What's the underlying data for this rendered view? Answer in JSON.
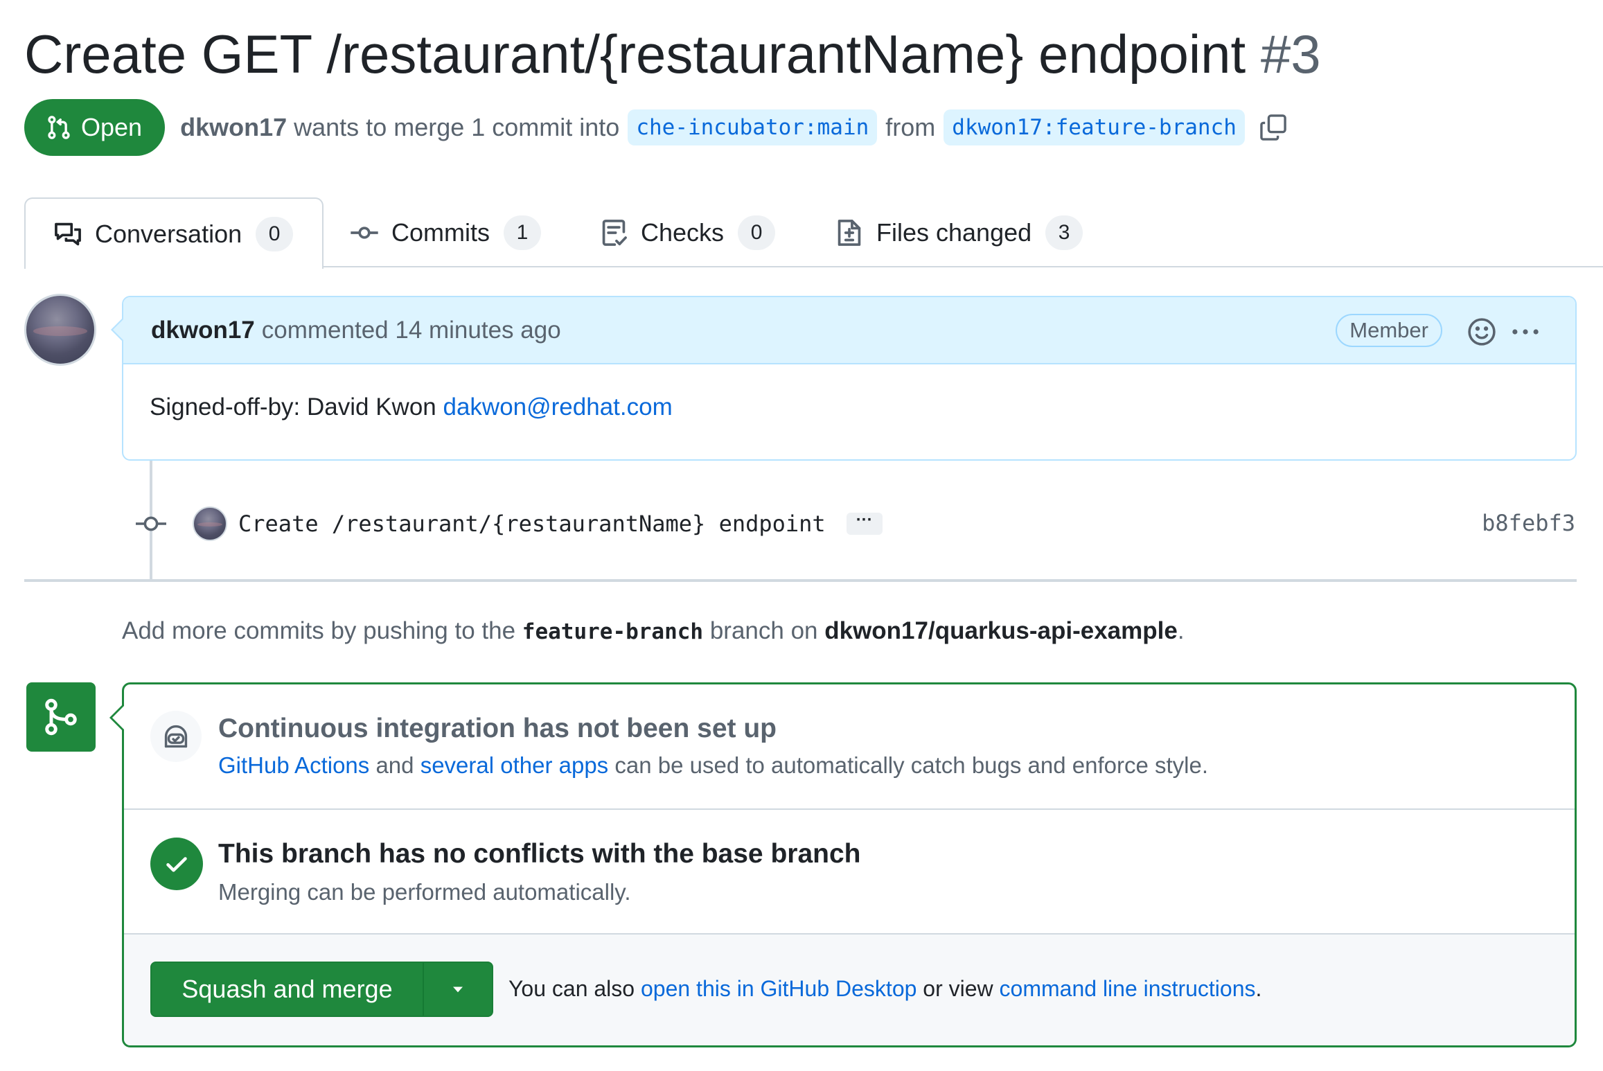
{
  "pr": {
    "title": "Create GET /restaurant/{restaurantName} endpoint",
    "number": "#3",
    "state": "Open",
    "author": "dkwon17",
    "merge_text": "wants to merge 1 commit into",
    "base_branch": "che-incubator:main",
    "from_text": "from",
    "head_branch": "dkwon17:feature-branch"
  },
  "tabs": [
    {
      "label": "Conversation",
      "count": "0",
      "icon": "comment-discussion-icon"
    },
    {
      "label": "Commits",
      "count": "1",
      "icon": "git-commit-icon"
    },
    {
      "label": "Checks",
      "count": "0",
      "icon": "checklist-icon"
    },
    {
      "label": "Files changed",
      "count": "3",
      "icon": "file-diff-icon"
    }
  ],
  "comment": {
    "author": "dkwon17",
    "meta": "commented 14 minutes ago",
    "badge": "Member",
    "body_prefix": "Signed-off-by: David Kwon",
    "email": "dakwon@redhat.com"
  },
  "commit": {
    "message": "Create /restaurant/{restaurantName} endpoint",
    "ellipsis": "···",
    "sha": "b8febf3"
  },
  "push_note": {
    "prefix": "Add more commits by pushing to the",
    "branch": "feature-branch",
    "middle": "branch on",
    "repo": "dkwon17/quarkus-api-example",
    "suffix": "."
  },
  "merge_box": {
    "ci_title": "Continuous integration has not been set up",
    "ci_link1": "GitHub Actions",
    "ci_and": "and",
    "ci_link2": "several other apps",
    "ci_rest": "can be used to automatically catch bugs and enforce style.",
    "conflict_title": "This branch has no conflicts with the base branch",
    "conflict_sub": "Merging can be performed automatically.",
    "button_label": "Squash and merge",
    "alt_prefix": "You can also",
    "alt_link1": "open this in GitHub Desktop",
    "alt_middle": "or view",
    "alt_link2": "command line instructions",
    "alt_suffix": "."
  },
  "colors": {
    "green": "#1f883d",
    "link": "#0969da",
    "comment_header": "#ddf4ff",
    "muted": "#59636e"
  }
}
